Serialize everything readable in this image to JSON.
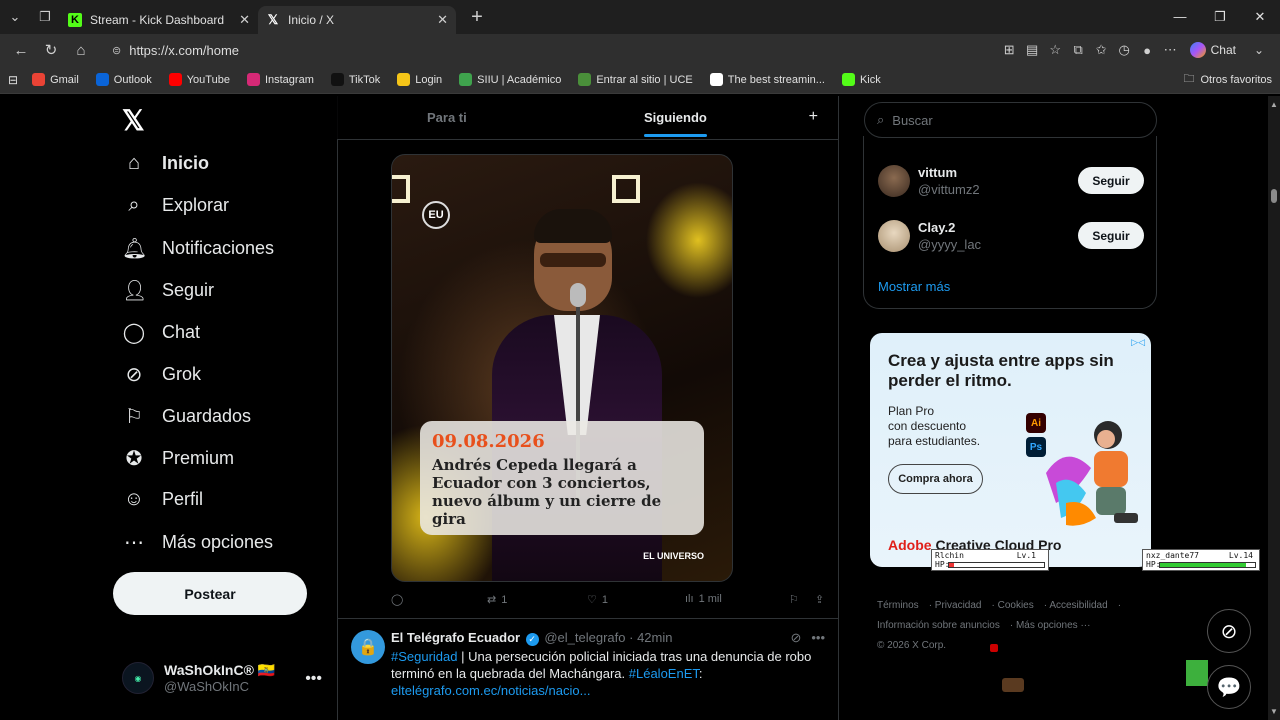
{
  "browser": {
    "tabs": [
      {
        "title": "Stream - Kick Dashboard",
        "icon": "kick-icon",
        "active": false
      },
      {
        "title": "Inicio / X",
        "icon": "x-icon",
        "active": true
      }
    ],
    "url": "https://x.com/home",
    "chat_label": "Chat",
    "bookmarks": [
      {
        "label": "Gmail",
        "icon": "gmail-icon",
        "color": "#ea4335"
      },
      {
        "label": "Outlook",
        "icon": "outlook-icon",
        "color": "#0a64d8"
      },
      {
        "label": "YouTube",
        "icon": "youtube-icon",
        "color": "#ff0000"
      },
      {
        "label": "Instagram",
        "icon": "instagram-icon",
        "color": "#d62976"
      },
      {
        "label": "TikTok",
        "icon": "tiktok-icon",
        "color": "#111111"
      },
      {
        "label": "Login",
        "icon": "login-icon",
        "color": "#f5c518"
      },
      {
        "label": "SIIU | Académico",
        "icon": "siiu-icon",
        "color": "#3fa34d"
      },
      {
        "label": "Entrar al sitio | UCE",
        "icon": "uce-icon",
        "color": "#4a8f3a"
      },
      {
        "label": "The best streamin...",
        "icon": "stream-icon",
        "color": "#ffffff"
      },
      {
        "label": "Kick",
        "icon": "kick-icon",
        "color": "#53fc18"
      }
    ],
    "other_favorites": "Otros favoritos"
  },
  "nav": {
    "items": [
      {
        "label": "Inicio",
        "icon": "home-icon"
      },
      {
        "label": "Explorar",
        "icon": "search-icon"
      },
      {
        "label": "Notificaciones",
        "icon": "bell-icon"
      },
      {
        "label": "Seguir",
        "icon": "person-add-icon"
      },
      {
        "label": "Chat",
        "icon": "chat-icon"
      },
      {
        "label": "Grok",
        "icon": "grok-icon"
      },
      {
        "label": "Guardados",
        "icon": "bookmark-icon"
      },
      {
        "label": "Premium",
        "icon": "verified-icon"
      },
      {
        "label": "Perfil",
        "icon": "profile-icon"
      },
      {
        "label": "Más opciones",
        "icon": "more-circle-icon"
      }
    ],
    "post_label": "Postear",
    "profile": {
      "name": "WaShOkInC® 🇪🇨",
      "handle": "@WaShOkInC"
    }
  },
  "timeline": {
    "tabs": [
      "Para ti",
      "Siguiendo"
    ],
    "active_tab": "Siguiendo",
    "media": {
      "badge": "EU",
      "date": "09.08.2026",
      "headline": "Andrés Cepeda llegará a Ecuador con 3 conciertos, nuevo álbum y un cierre de gira",
      "brand": "EL UNIVERSO"
    },
    "actions": {
      "reposts": "1",
      "likes": "1",
      "views": "1 mil"
    },
    "tweet2": {
      "name": "El Telégrafo Ecuador",
      "handle": "@el_telegrafo",
      "time": "42min",
      "hashtag1": "#Seguridad",
      "text": " | Una persecución policial iniciada tras una denuncia de robo terminó en la quebrada del Machángara. ",
      "hashtag2": "#LéaloEnET",
      "link": "eltelégrafo.com.ec/noticias/nacio..."
    }
  },
  "right": {
    "search_placeholder": "Buscar",
    "who_to_follow": [
      {
        "name": "vittum",
        "handle": "@vittumz2",
        "button": "Seguir"
      },
      {
        "name": "Clay.2",
        "handle": "@yyyy_lac",
        "button": "Seguir"
      }
    ],
    "show_more": "Mostrar más",
    "ad": {
      "headline": "Crea y ajusta entre apps sin perder el ritmo.",
      "plan": "Plan Pro",
      "line2": "con descuento",
      "line3": "para estudiantes.",
      "cta": "Compra ahora",
      "brand_a": "Adobe",
      "brand_b": " Creative Cloud Pro"
    },
    "footer": {
      "links": [
        "Términos",
        "Privacidad",
        "Cookies",
        "Accesibilidad",
        "Información sobre anuncios",
        "Más opciones ···"
      ],
      "copyright": "© 2026 X Corp."
    }
  },
  "overlays": {
    "player1": {
      "name": "Rlchin",
      "level": "Lv.1",
      "hp_label": "HP:",
      "hp": 0.05
    },
    "player2": {
      "name": "nxz_dante77",
      "level": "Lv.14",
      "hp_label": "HP:",
      "hp": 0.9
    }
  }
}
